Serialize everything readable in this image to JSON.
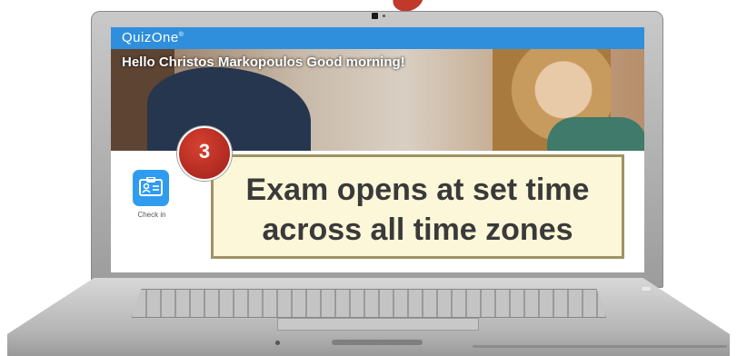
{
  "app": {
    "brand": "QuizOne",
    "trademark": "®"
  },
  "banner": {
    "greeting": "Hello Christos Markopoulos Good morning!"
  },
  "tiles": [
    {
      "label": "Check in",
      "icon": "id-card-icon",
      "color": "#2f9cf0"
    }
  ],
  "callout": {
    "step": "3",
    "line1": "Exam opens at set time",
    "line2": "across all time zones"
  },
  "colors": {
    "topbar": "#2f8fdc",
    "badge": "#c0392b",
    "callout_bg": "#fbf7d8",
    "callout_border": "#9e9365"
  }
}
